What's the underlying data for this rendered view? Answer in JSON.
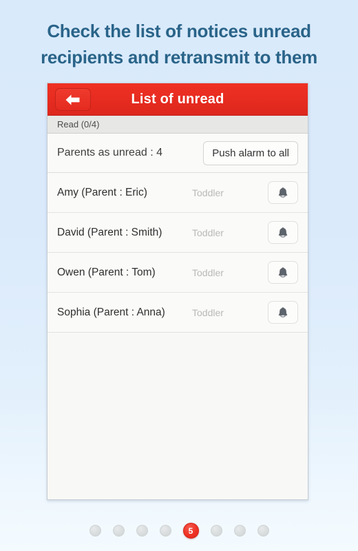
{
  "headline": {
    "line1": "Check the list of notices unread",
    "line2": "recipients and retransmit to them"
  },
  "appbar": {
    "title": "List of unread",
    "back_icon": "arrow-left-icon"
  },
  "read_status": "Read (0/4)",
  "summary": {
    "label": "Parents as unread : 4",
    "push_all_label": "Push alarm to all"
  },
  "list": {
    "rows": [
      {
        "name": "Amy (Parent : Eric)",
        "class": "Toddler",
        "bell_icon": "bell-icon"
      },
      {
        "name": "David (Parent : Smith)",
        "class": "Toddler",
        "bell_icon": "bell-icon"
      },
      {
        "name": "Owen (Parent : Tom)",
        "class": "Toddler",
        "bell_icon": "bell-icon"
      },
      {
        "name": "Sophia (Parent : Anna)",
        "class": "Toddler",
        "bell_icon": "bell-icon"
      }
    ]
  },
  "pager": {
    "total": 8,
    "active_index": 5,
    "active_label": "5"
  },
  "colors": {
    "accent_red": "#ee3225",
    "headline_blue": "#2a6489",
    "background_blue": "#d9eafb",
    "panel": "#f8f8f6",
    "muted_text": "#b9b9b9"
  }
}
